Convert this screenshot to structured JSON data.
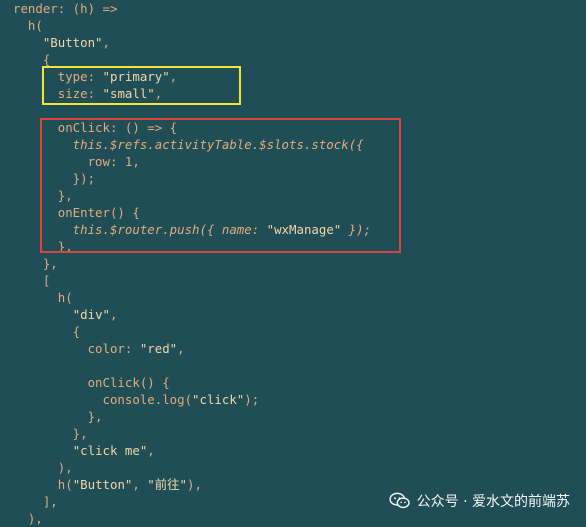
{
  "colors": {
    "background": "#1f4e57",
    "code_text": "#e3ab7c",
    "string_text": "#f2d5a6",
    "yellow_box": "#f0e63a",
    "red_box": "#d9443c",
    "watermark_text": "#f4f4f4"
  },
  "code_lines": [
    "render: (h) =>",
    "  h(",
    "    \"Button\",",
    "    {",
    "      type: \"primary\",",
    "      size: \"small\",",
    "",
    "      onClick: () => {",
    "        this.$refs.activityTable.$slots.stock({",
    "          row: 1,",
    "        });",
    "      },",
    "      onEnter() {",
    "        this.$router.push({ name: \"wxManage\" });",
    "      },",
    "    },",
    "    [",
    "      h(",
    "        \"div\",",
    "        {",
    "          color: \"red\",",
    "",
    "          onClick() {",
    "            console.log(\"click\");",
    "          },",
    "        },",
    "        \"click me\",",
    "      ),",
    "      h(\"Button\", \"前往\"),",
    "    ],",
    "  ),"
  ],
  "watermark": {
    "icon": "wechat-icon",
    "text": "公众号 · 爱水文的前端苏"
  }
}
